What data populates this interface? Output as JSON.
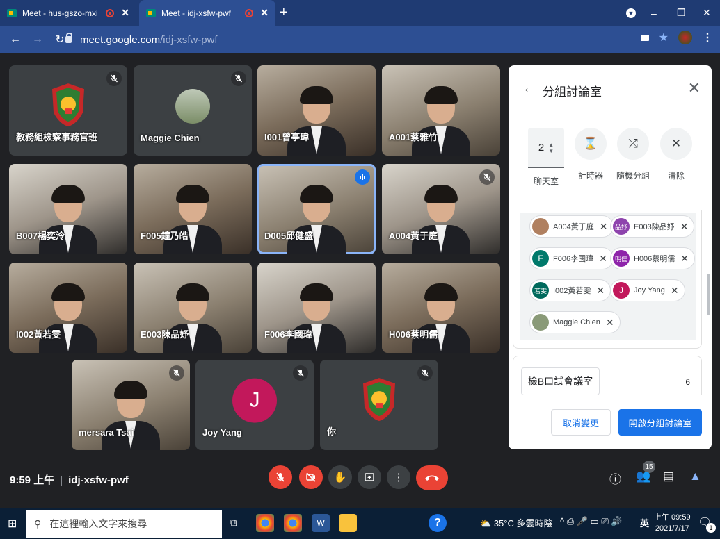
{
  "browser": {
    "tabs": [
      {
        "title": "Meet - hus-gszo-mxi"
      },
      {
        "title": "Meet - idj-xsfw-pwf"
      }
    ],
    "url_domain": "meet.google.com",
    "url_path": "/idj-xsfw-pwf"
  },
  "tiles": [
    {
      "name": "教務組檢察事務官班",
      "kind": "crest",
      "muted": true
    },
    {
      "name": "Maggie Chien",
      "kind": "photo",
      "muted": true
    },
    {
      "name": "I001曾亭瑋",
      "kind": "cam",
      "muted": false
    },
    {
      "name": "A001蔡雅竹",
      "kind": "cam",
      "muted": false
    },
    {
      "name": "B007楊奕泠",
      "kind": "cam",
      "muted": false
    },
    {
      "name": "F005鐘乃皓",
      "kind": "cam",
      "muted": false
    },
    {
      "name": "D005邱健盛",
      "kind": "cam",
      "muted": false,
      "speaking": true
    },
    {
      "name": "A004黃于庭",
      "kind": "cam",
      "muted": true
    },
    {
      "name": "I002黃若雯",
      "kind": "cam",
      "muted": false
    },
    {
      "name": "E003陳品妤",
      "kind": "cam",
      "muted": false
    },
    {
      "name": "F006李國瑋",
      "kind": "cam",
      "muted": false
    },
    {
      "name": "H006蔡明儒",
      "kind": "cam",
      "muted": false
    },
    {
      "name": "mersara Tsai",
      "kind": "cam",
      "muted": true
    },
    {
      "name": "Joy Yang",
      "kind": "letter",
      "letter": "J",
      "muted": true
    },
    {
      "name": "你",
      "kind": "crest",
      "muted": true
    }
  ],
  "panel": {
    "title": "分組討論室",
    "room_count": "2",
    "controls": [
      "聊天室",
      "計時器",
      "隨機分組",
      "清除"
    ],
    "chips": [
      {
        "label": "A004黃于庭",
        "avatar": "",
        "color": "#b08060"
      },
      {
        "label": "E003陳品妤",
        "avatar": "品妤",
        "color": "#8e44ad"
      },
      {
        "label": "F006李國瑋",
        "avatar": "F",
        "color": "#00796b"
      },
      {
        "label": "H006蔡明儒",
        "avatar": "明儒",
        "color": "#8e24aa"
      },
      {
        "label": "I002黃若雯",
        "avatar": "若雯",
        "color": "#00695c"
      },
      {
        "label": "Joy Yang",
        "avatar": "J",
        "color": "#c2185b"
      },
      {
        "label": "Maggie Chien",
        "avatar": "",
        "color": "#8a9a78"
      }
    ],
    "room2": {
      "name": "檢B口試會議室",
      "count": "6"
    },
    "cancel": "取消變更",
    "open": "開啟分組討論室"
  },
  "bottom": {
    "time": "9:59 上午",
    "meeting_code": "idj-xsfw-pwf",
    "participants_badge": "15"
  },
  "taskbar": {
    "search_placeholder": "在這裡輸入文字來搜尋",
    "weather": "35°C 多雲時陰",
    "ime": "英",
    "time": "上午 09:59",
    "date": "2021/7/17",
    "notif": "1"
  },
  "colors": {
    "accent": "#1a73e8",
    "danger": "#ea4335",
    "bg": "#202124"
  }
}
